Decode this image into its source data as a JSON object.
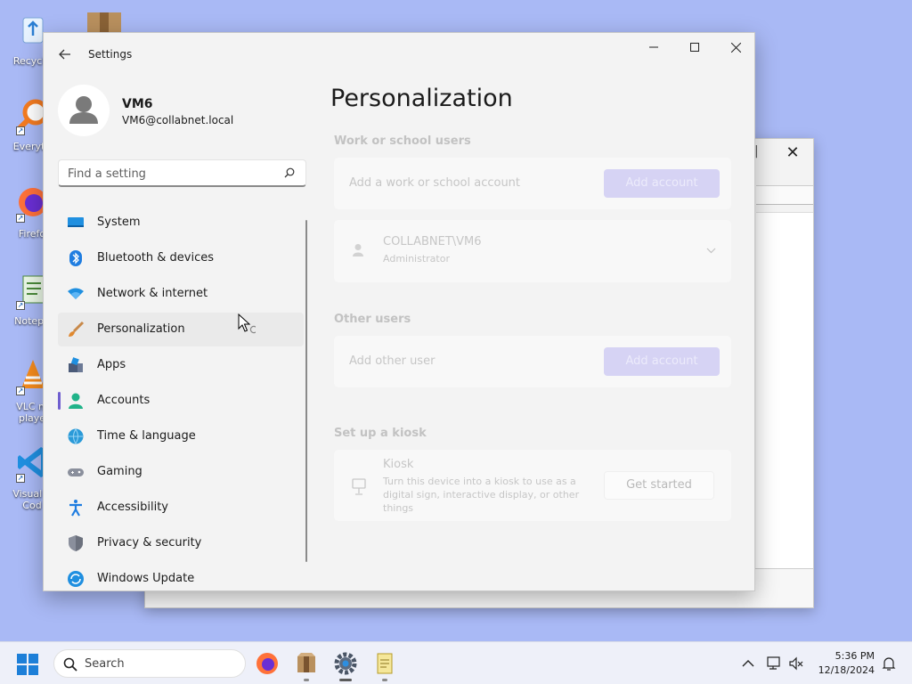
{
  "desktop": {
    "icons": [
      {
        "label": "Recycle",
        "icon": "recycle-bin-icon"
      },
      {
        "label": "Everyth",
        "icon": "everything-search-icon"
      },
      {
        "label": "Firefo",
        "icon": "firefox-icon"
      },
      {
        "label": "Notepa",
        "icon": "notepad-icon"
      },
      {
        "label": "VLC m\nplaye",
        "icon": "vlc-icon"
      },
      {
        "label": "Visual S\nCod",
        "icon": "vscode-icon"
      }
    ]
  },
  "window": {
    "title": "Settings",
    "controls": {
      "minimize": "—",
      "maximize": "☐",
      "close": "✕"
    }
  },
  "profile": {
    "name": "VM6",
    "email": "VM6@collabnet.local"
  },
  "search": {
    "placeholder": "Find a setting"
  },
  "nav": {
    "items": [
      {
        "label": "System",
        "icon": "system-monitor-icon"
      },
      {
        "label": "Bluetooth & devices",
        "icon": "bluetooth-icon"
      },
      {
        "label": "Network & internet",
        "icon": "wifi-icon"
      },
      {
        "label": "Personalization",
        "icon": "paintbrush-icon"
      },
      {
        "label": "Apps",
        "icon": "apps-icon"
      },
      {
        "label": "Accounts",
        "icon": "accounts-icon"
      },
      {
        "label": "Time & language",
        "icon": "globe-clock-icon"
      },
      {
        "label": "Gaming",
        "icon": "gamepad-icon"
      },
      {
        "label": "Accessibility",
        "icon": "accessibility-icon"
      },
      {
        "label": "Privacy & security",
        "icon": "shield-icon"
      },
      {
        "label": "Windows Update",
        "icon": "update-icon"
      }
    ],
    "selected": "Accounts",
    "hovered": "Personalization"
  },
  "main": {
    "title": "Personalization",
    "work_section": {
      "heading": "Work or school users",
      "add_text": "Add a work or school account",
      "add_button": "Add account",
      "user_name": "COLLABNET\\VM6",
      "user_role": "Administrator"
    },
    "other_section": {
      "heading": "Other users",
      "add_text": "Add other user",
      "add_button": "Add account"
    },
    "kiosk_section": {
      "heading": "Set up a kiosk",
      "title": "Kiosk",
      "description": "Turn this device into a kiosk to use as a digital sign, interactive display, or other things",
      "button": "Get started"
    }
  },
  "taskbar": {
    "search_label": "Search",
    "time": "5:36 PM",
    "date": "12/18/2024"
  },
  "colors": {
    "accent": "#6f5ecf",
    "desktop": "#a9b9f5"
  }
}
